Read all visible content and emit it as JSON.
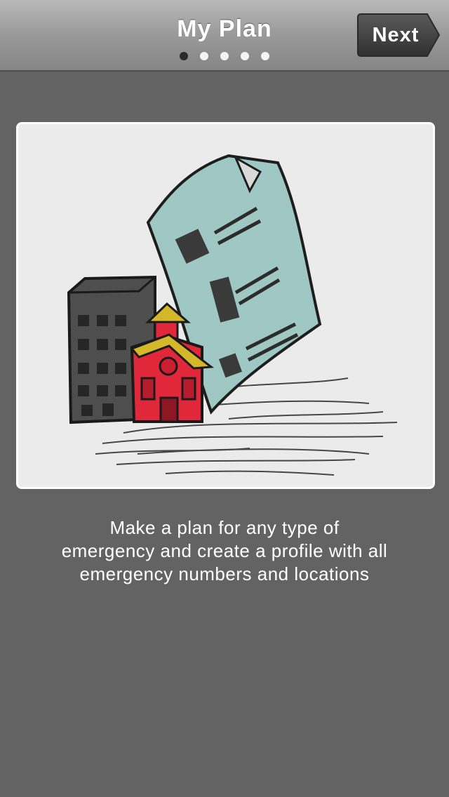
{
  "navbar": {
    "title": "My Plan",
    "next_label": "Next",
    "pager": {
      "total": 5,
      "active": 1
    }
  },
  "illustration": {
    "icon": "emergency-plan-sketch"
  },
  "description": {
    "line1": "Make a plan for any type of",
    "line2": "emergency and create a profile with all",
    "line3": "emergency numbers and locations"
  },
  "colors": {
    "background": "#636363",
    "navbar_top": "#b9b9b9",
    "navbar_bottom": "#858585",
    "next_button": "#3d3d3d",
    "document": "#9fc8c4",
    "house": "#e0283a",
    "roof": "#d4b82a",
    "building": "#4e4e4e"
  }
}
